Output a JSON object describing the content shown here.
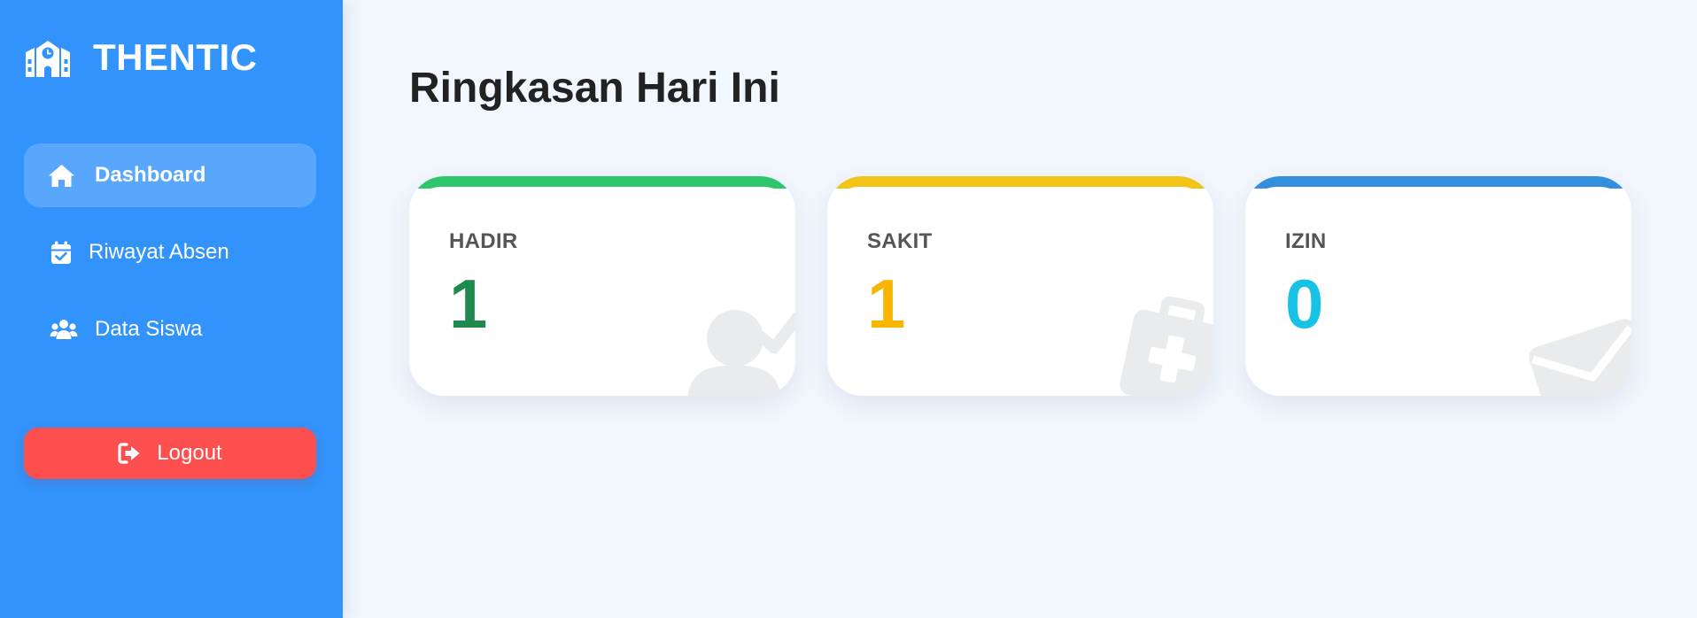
{
  "app": {
    "name": "THENTIC",
    "logo_icon": "school-icon"
  },
  "sidebar": {
    "items": [
      {
        "label": "Dashboard",
        "icon": "home-icon",
        "active": true
      },
      {
        "label": "Riwayat Absen",
        "icon": "calendar-check-icon",
        "active": false
      },
      {
        "label": "Data Siswa",
        "icon": "users-icon",
        "active": false
      }
    ],
    "logout": {
      "label": "Logout",
      "icon": "logout-icon",
      "color": "#fe4f4f"
    },
    "color": "#3193fb"
  },
  "main": {
    "title": "Ringkasan Hari Ini",
    "cards": [
      {
        "label": "HADIR",
        "value": "1",
        "accent": "#2ec66d",
        "value_color": "#1e8a4e",
        "icon": "user-check-icon"
      },
      {
        "label": "SAKIT",
        "value": "1",
        "accent": "#f1c417",
        "value_color": "#f7b500",
        "icon": "medkit-icon"
      },
      {
        "label": "IZIN",
        "value": "0",
        "accent": "#3490dc",
        "value_color": "#16c2e6",
        "icon": "envelope-icon"
      }
    ]
  }
}
